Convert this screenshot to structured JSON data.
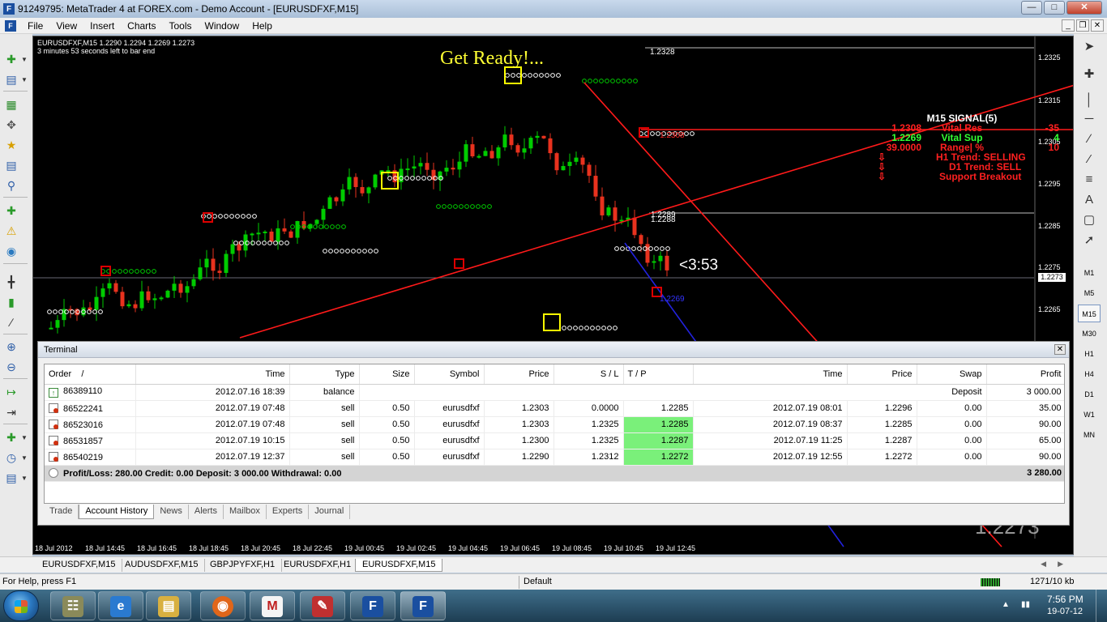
{
  "window": {
    "title": "91249795: MetaTrader 4 at FOREX.com - Demo Account - [EURUSDFXF,M15]"
  },
  "menu": [
    {
      "label": "File"
    },
    {
      "label": "View"
    },
    {
      "label": "Insert"
    },
    {
      "label": "Charts"
    },
    {
      "label": "Tools"
    },
    {
      "label": "Window"
    },
    {
      "label": "Help"
    }
  ],
  "chart": {
    "header_line1": "EURUSDFXF,M15  1.2290 1.2294 1.2269 1.2273",
    "header_line2": "3 minutes 53 seconds left to bar end",
    "get_ready": "Get Ready!...",
    "countdown": "<3:53",
    "watermark_price": "1.2273",
    "current_price": "1.2273",
    "price_labels": [
      "1.2325",
      "1.2315",
      "1.2305",
      "1.2295",
      "1.2285",
      "1.2275",
      "1.2265"
    ],
    "level_labels": {
      "top": "1.2328",
      "resistance": "1.2308",
      "mid_a": "1.2289",
      "mid_b": "1.2288",
      "low": "1.2269"
    },
    "time_labels": [
      "18 Jul 2012",
      "18 Jul 14:45",
      "18 Jul 16:45",
      "18 Jul 18:45",
      "18 Jul 20:45",
      "18 Jul 22:45",
      "19 Jul 00:45",
      "19 Jul 02:45",
      "19 Jul 04:45",
      "19 Jul 06:45",
      "19 Jul 08:45",
      "19 Jul 10:45",
      "19 Jul 12:45"
    ],
    "colors": {
      "background": "#000000",
      "bull": "#00cc00",
      "bear": "#e8321e",
      "trend": "#ff1a1a",
      "channel": "#2222dd",
      "highlight_box": "#ffff00"
    },
    "signal": {
      "title": "M15 SIGNAL(5)",
      "rows": [
        {
          "price": "1.2308",
          "label": "Vital Res",
          "value": "-35",
          "color": "#ff2020"
        },
        {
          "price": "1.2269",
          "label": "Vital Sup",
          "value": "4",
          "color": "#33ff33"
        },
        {
          "price": "39.0000",
          "label": "Range| %",
          "value": "10",
          "color": "#ff2020"
        }
      ],
      "h1_trend": "H1 Trend: SELLING",
      "d1_trend": "D1 Trend: SELL",
      "support_breakout": "Support Breakout",
      "arrow_glyph": "⇩"
    }
  },
  "terminal": {
    "title": "Terminal",
    "columns": [
      "Order",
      "Time",
      "Type",
      "Size",
      "Symbol",
      "Price",
      "S / L",
      "T / P",
      "Time",
      "Price",
      "Swap",
      "Profit"
    ],
    "sort_marker": "/",
    "balance_row": {
      "order": "86389110",
      "time": "2012.07.16 18:39",
      "type": "balance",
      "comment": "Deposit",
      "profit": "3 000.00"
    },
    "rows": [
      {
        "order": "86522241",
        "open_time": "2012.07.19 07:48",
        "type": "sell",
        "size": "0.50",
        "symbol": "eurusdfxf",
        "price": "1.2303",
        "sl": "0.0000",
        "tp": "1.2285",
        "close_time": "2012.07.19 08:01",
        "close_price": "1.2296",
        "swap": "0.00",
        "profit": "35.00",
        "tp_hit": false
      },
      {
        "order": "86523016",
        "open_time": "2012.07.19 07:48",
        "type": "sell",
        "size": "0.50",
        "symbol": "eurusdfxf",
        "price": "1.2303",
        "sl": "1.2325",
        "tp": "1.2285",
        "close_time": "2012.07.19 08:37",
        "close_price": "1.2285",
        "swap": "0.00",
        "profit": "90.00",
        "tp_hit": true
      },
      {
        "order": "86531857",
        "open_time": "2012.07.19 10:15",
        "type": "sell",
        "size": "0.50",
        "symbol": "eurusdfxf",
        "price": "1.2300",
        "sl": "1.2325",
        "tp": "1.2287",
        "close_time": "2012.07.19 11:25",
        "close_price": "1.2287",
        "swap": "0.00",
        "profit": "65.00",
        "tp_hit": true
      },
      {
        "order": "86540219",
        "open_time": "2012.07.19 12:37",
        "type": "sell",
        "size": "0.50",
        "symbol": "eurusdfxf",
        "price": "1.2290",
        "sl": "1.2312",
        "tp": "1.2272",
        "close_time": "2012.07.19 12:55",
        "close_price": "1.2272",
        "swap": "0.00",
        "profit": "90.00",
        "tp_hit": true
      }
    ],
    "summary": {
      "text": "Profit/Loss: 280.00  Credit: 0.00  Deposit: 3 000.00  Withdrawal: 0.00",
      "total": "3 280.00"
    },
    "tabs": [
      {
        "label": "Trade",
        "active": false
      },
      {
        "label": "Account History",
        "active": true
      },
      {
        "label": "News",
        "active": false
      },
      {
        "label": "Alerts",
        "active": false
      },
      {
        "label": "Mailbox",
        "active": false
      },
      {
        "label": "Experts",
        "active": false
      },
      {
        "label": "Journal",
        "active": false
      }
    ]
  },
  "chart_tabs": [
    {
      "label": "EURUSDFXF,M15",
      "active": false
    },
    {
      "label": "AUDUSDFXF,M15",
      "active": false
    },
    {
      "label": "GBPJPYFXF,H1",
      "active": false
    },
    {
      "label": "EURUSDFXF,H1",
      "active": false
    },
    {
      "label": "EURUSDFXF,M15",
      "active": true
    }
  ],
  "timeframes": [
    {
      "label": "M1",
      "active": false
    },
    {
      "label": "M5",
      "active": false
    },
    {
      "label": "M15",
      "active": true
    },
    {
      "label": "M30",
      "active": false
    },
    {
      "label": "H1",
      "active": false
    },
    {
      "label": "H4",
      "active": false
    },
    {
      "label": "D1",
      "active": false
    },
    {
      "label": "W1",
      "active": false
    },
    {
      "label": "MN",
      "active": false
    }
  ],
  "status": {
    "help": "For Help, press F1",
    "profile": "Default",
    "traffic": "1271/10 kb"
  },
  "taskbar": {
    "time": "7:56 PM",
    "date": "19-07-12"
  }
}
